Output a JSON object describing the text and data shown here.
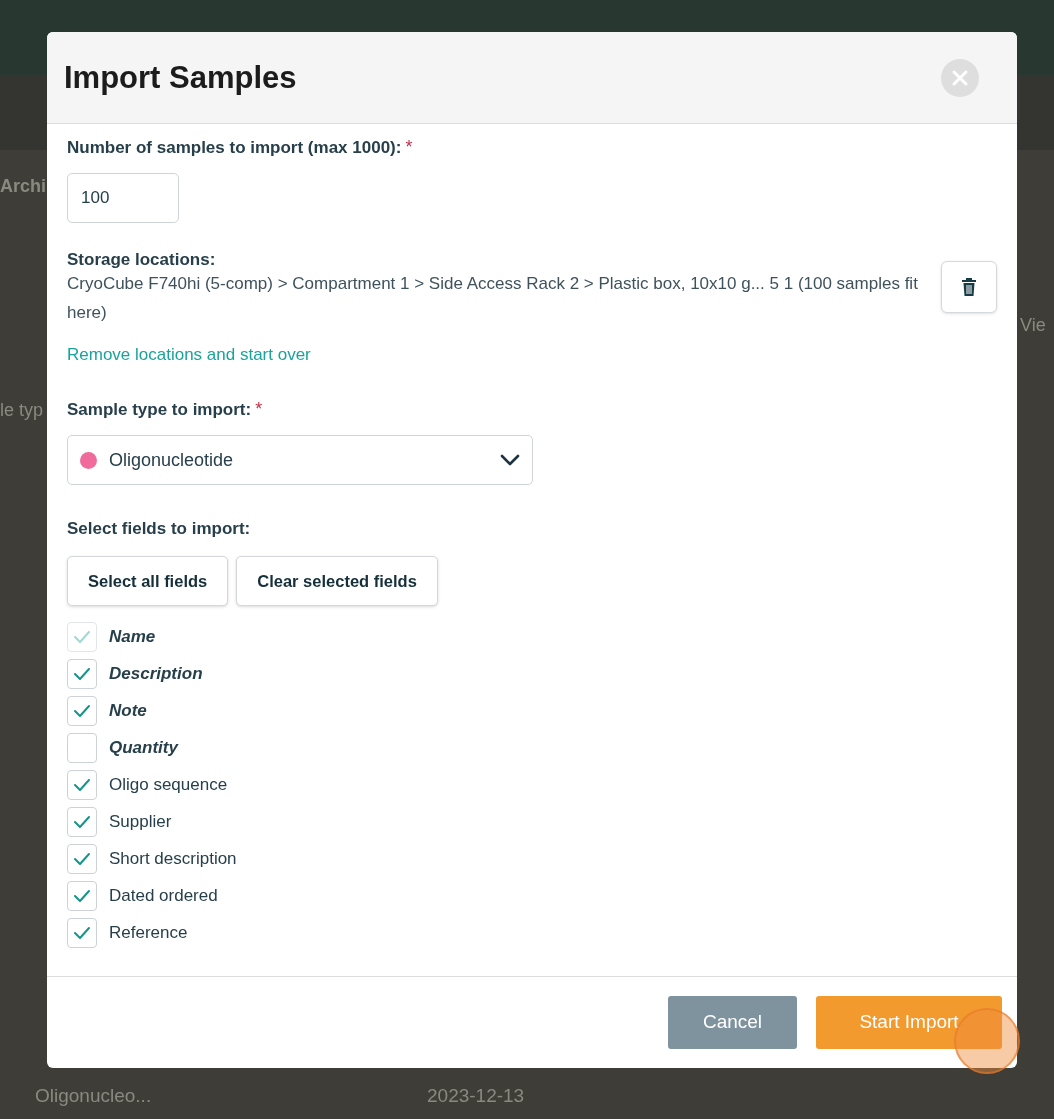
{
  "background": {
    "texts": [
      {
        "kind": "section",
        "text": "Archi"
      },
      {
        "kind": "label",
        "text": "le typ"
      },
      {
        "kind": "link",
        "text": "Vie"
      }
    ],
    "bottom_row": [
      "Oligonucleo...",
      "2023-12-13"
    ]
  },
  "dialog": {
    "title": "Import Samples",
    "count": {
      "label": "Number of samples to import (max 1000):",
      "required_mark": "*",
      "value": "100"
    },
    "storage": {
      "label": "Storage locations:",
      "path": "CryoCube F740hi (5-comp) > Compartment 1 > Side Access Rack 2 > Plastic box, 10x10 g... 5 1  (100 samples fit here)",
      "reset_link": "Remove locations and start over"
    },
    "sample_type": {
      "label": "Sample type to import:",
      "required_mark": "*",
      "value": "Oligonucleotide",
      "color": "#f06b9b"
    },
    "fields": {
      "label": "Select fields to import:",
      "buttons": [
        "Select all fields",
        "Clear selected fields"
      ],
      "items": [
        {
          "label": "Name",
          "kind": "builtin",
          "checked": true,
          "disabled": true
        },
        {
          "label": "Description",
          "kind": "builtin",
          "checked": true,
          "disabled": false
        },
        {
          "label": "Note",
          "kind": "builtin",
          "checked": true,
          "disabled": false
        },
        {
          "label": "Quantity",
          "kind": "builtin",
          "checked": false,
          "disabled": false
        },
        {
          "label": "Oligo sequence",
          "kind": "custom",
          "checked": true,
          "disabled": false
        },
        {
          "label": "Supplier",
          "kind": "custom",
          "checked": true,
          "disabled": false
        },
        {
          "label": "Short description",
          "kind": "custom",
          "checked": true,
          "disabled": false
        },
        {
          "label": "Dated ordered",
          "kind": "custom",
          "checked": true,
          "disabled": false
        },
        {
          "label": "Reference",
          "kind": "custom",
          "checked": true,
          "disabled": false
        }
      ]
    },
    "footer": {
      "buttons": [
        {
          "label": "Cancel",
          "kind": "secondary"
        },
        {
          "label": "Start Import",
          "kind": "primary"
        }
      ]
    }
  }
}
